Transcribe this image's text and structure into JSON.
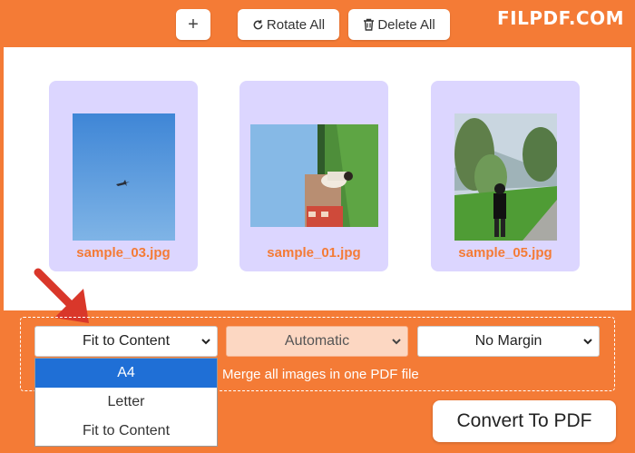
{
  "toolbar": {
    "add_label": "+",
    "rotate_label": "Rotate All",
    "delete_label": "Delete All"
  },
  "brand": {
    "logo": "FILPDF.COM"
  },
  "files": [
    {
      "name": "sample_03.jpg"
    },
    {
      "name": "sample_01.jpg"
    },
    {
      "name": "sample_05.jpg"
    }
  ],
  "options": {
    "page_size": {
      "selected": "Fit to Content",
      "open": true,
      "options": [
        "A4",
        "Letter",
        "Fit to Content"
      ],
      "highlighted": "A4"
    },
    "orientation": {
      "selected": "Automatic"
    },
    "margin": {
      "selected": "No Margin"
    },
    "merge_label": "Merge all images in one PDF file"
  },
  "actions": {
    "convert_label": "Convert To PDF"
  },
  "colors": {
    "brand": "#f47b36",
    "card_bg": "#dcd6ff",
    "highlight": "#1f6fd6",
    "annotation_arrow": "#d9372a"
  },
  "icons": {
    "add": "plus-icon",
    "rotate": "rotate-icon",
    "delete": "trash-icon",
    "dropdown": "chevron-down-icon",
    "annotation": "red-arrow-icon"
  }
}
